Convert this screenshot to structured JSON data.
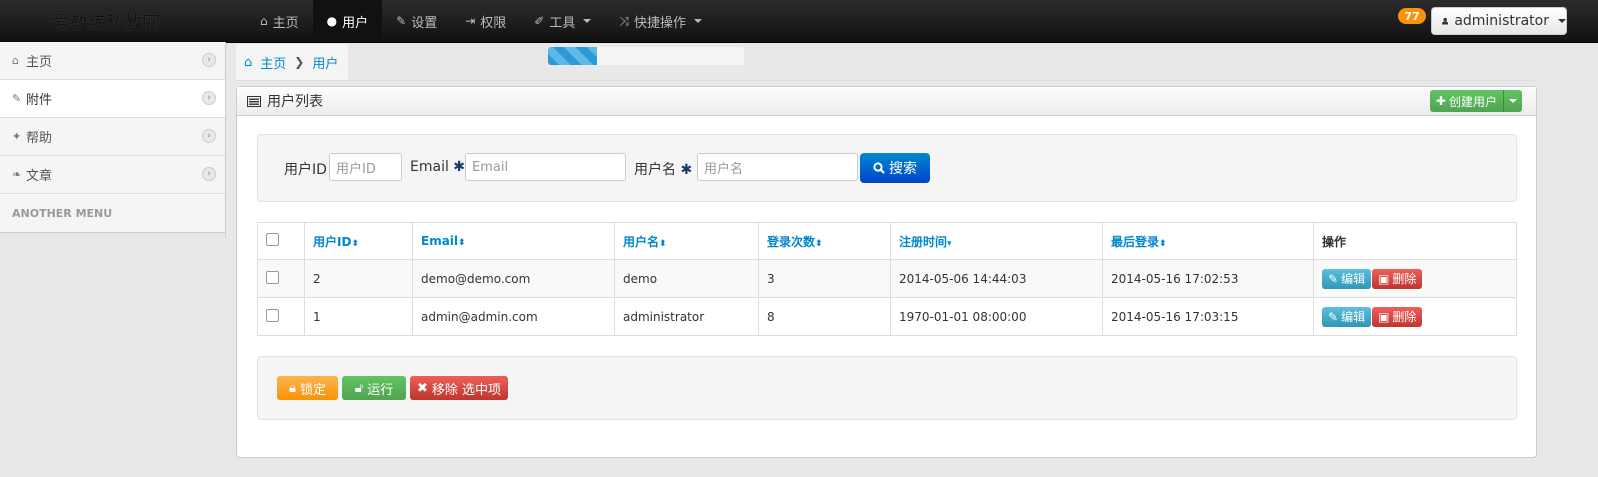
{
  "brand": "爱教练私教网",
  "nav": {
    "items": [
      {
        "label": "主页",
        "icon": "home-icon",
        "glyph": "⌂"
      },
      {
        "label": "用户",
        "icon": "user-icon",
        "glyph": "●"
      },
      {
        "label": "设置",
        "icon": "wrench-icon",
        "glyph": "✎"
      },
      {
        "label": "权限",
        "icon": "lock-icon",
        "glyph": "⇥"
      },
      {
        "label": "工具",
        "icon": "pencil-icon",
        "glyph": "✐"
      },
      {
        "label": "快捷操作",
        "icon": "shuffle-icon",
        "glyph": "⤨"
      }
    ],
    "badge": "77",
    "user": "administrator"
  },
  "sidebar": {
    "items": [
      {
        "label": "主页",
        "glyph": "⌂"
      },
      {
        "label": "附件",
        "glyph": "✎"
      },
      {
        "label": "帮助",
        "glyph": "✦"
      },
      {
        "label": "文章",
        "glyph": "❧"
      }
    ],
    "header": "ANOTHER MENU"
  },
  "breadcrumb": {
    "home": "主页",
    "current": "用户"
  },
  "progress": {
    "value": 0.25
  },
  "panel": {
    "title": "用户列表",
    "create_label": "创建用户"
  },
  "search": {
    "id_label": "用户ID",
    "id_placeholder": "用户ID",
    "email_label": "Email",
    "email_placeholder": "Email",
    "name_label": "用户名",
    "name_placeholder": "用户名",
    "required_mark": "✱",
    "button": "搜索"
  },
  "table": {
    "headers": [
      "用户ID",
      "Email",
      "用户名",
      "登录次数",
      "注册时间",
      "最后登录",
      "操作"
    ],
    "rows": [
      {
        "id": "2",
        "email": "demo@demo.com",
        "name": "demo",
        "logins": "3",
        "registered": "2014-05-06 14:44:03",
        "last": "2014-05-16 17:02:53"
      },
      {
        "id": "1",
        "email": "admin@admin.com",
        "name": "administrator",
        "logins": "8",
        "registered": "1970-01-01 08:00:00",
        "last": "2014-05-16 17:03:15"
      }
    ],
    "edit_label": "编辑",
    "delete_label": "删除"
  },
  "actions": {
    "lock": "锁定",
    "run": "运行",
    "remove": "移除 选中项"
  },
  "colors": {
    "link": "#0088cc",
    "primary": "#0044cc",
    "success": "#51a351",
    "warning": "#f89406",
    "danger": "#bd362f",
    "info": "#2f96b4"
  }
}
